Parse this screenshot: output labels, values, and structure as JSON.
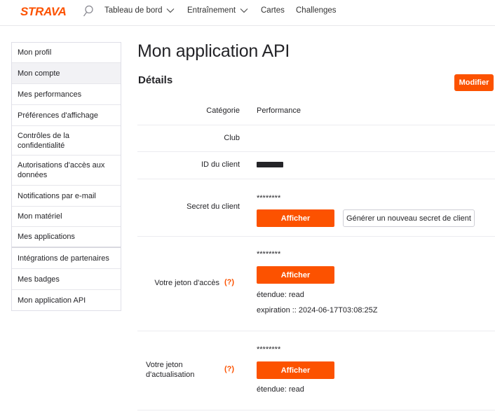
{
  "header": {
    "logo": "STRAVA",
    "nav": [
      {
        "label": "Tableau de bord",
        "dropdown": true
      },
      {
        "label": "Entraînement",
        "dropdown": true
      },
      {
        "label": "Cartes",
        "dropdown": false
      },
      {
        "label": "Challenges",
        "dropdown": false
      }
    ]
  },
  "sidebar": {
    "items": [
      {
        "label": "Mon profil"
      },
      {
        "label": "Mon compte"
      },
      {
        "label": "Mes performances"
      },
      {
        "label": "Préférences d'affichage"
      },
      {
        "label": "Contrôles de la confidentialité"
      },
      {
        "label": "Autorisations d'accès aux données"
      },
      {
        "label": "Notifications par e-mail"
      },
      {
        "label": "Mon matériel"
      },
      {
        "label": "Mes applications"
      },
      {
        "label": "Intégrations de partenaires"
      },
      {
        "label": "Mes badges"
      },
      {
        "label": "Mon application API"
      }
    ],
    "active_index": 1
  },
  "main": {
    "title": "Mon application API",
    "section": "Détails",
    "edit_label": "Modifier",
    "category": {
      "label": "Catégorie",
      "value": "Performance"
    },
    "club": {
      "label": "Club",
      "value": ""
    },
    "client_id": {
      "label": "ID du client"
    },
    "client_secret": {
      "label": "Secret du client",
      "masked": "********",
      "show_label": "Afficher",
      "regen_label": "Générer un nouveau secret de client"
    },
    "access_token": {
      "label": "Votre jeton d'accès",
      "help": "(?)",
      "masked": "********",
      "show_label": "Afficher",
      "scope": "étendue: read",
      "expiration": "expiration :: 2024-06-17T03:08:25Z"
    },
    "refresh_token": {
      "label_line1": "Votre jeton",
      "label_line2": "d'actualisation",
      "help": "(?)",
      "masked": "********",
      "show_label": "Afficher",
      "scope": "étendue: read"
    }
  },
  "colors": {
    "accent": "#fc5200",
    "text": "#242428"
  }
}
